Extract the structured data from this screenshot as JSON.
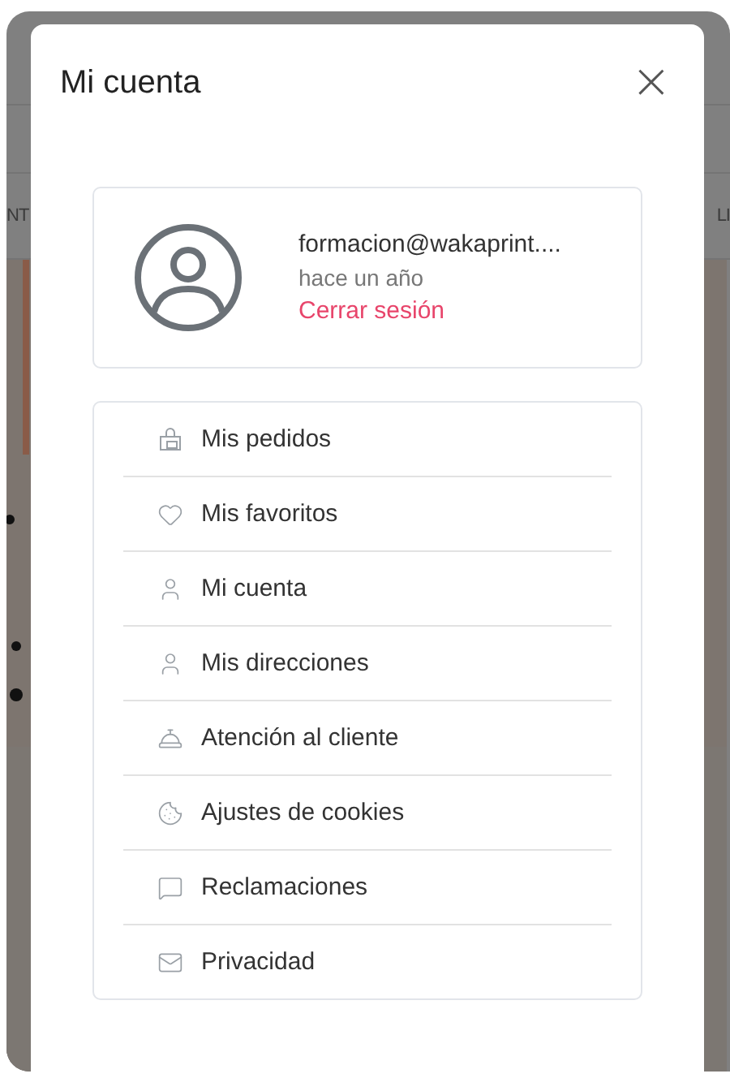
{
  "backdrop": {
    "left_text": "NT",
    "right_text": "LI"
  },
  "dialog": {
    "title": "Mi cuenta",
    "close": "×"
  },
  "profile": {
    "email": "formacion@wakaprint....",
    "since": "hace un año",
    "logout": "Cerrar sesión"
  },
  "menu": [
    {
      "label": "Mis pedidos"
    },
    {
      "label": "Mis favoritos"
    },
    {
      "label": "Mi cuenta"
    },
    {
      "label": "Mis direcciones"
    },
    {
      "label": "Atención al cliente"
    },
    {
      "label": "Ajustes de cookies"
    },
    {
      "label": "Reclamaciones"
    },
    {
      "label": "Privacidad"
    }
  ]
}
